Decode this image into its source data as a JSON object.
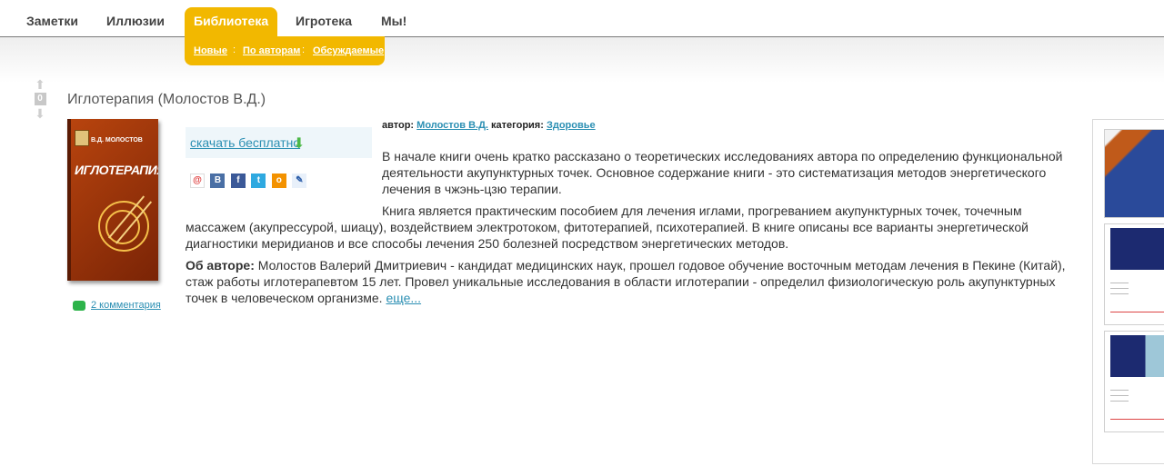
{
  "nav": {
    "items": [
      "Заметки",
      "Иллюзии",
      "Библиотека",
      "Игротека",
      "Мы!"
    ],
    "active_index": 2,
    "subnav": [
      "Новые",
      "По авторам",
      "Обсуждаемые"
    ],
    "sub_sep": ":"
  },
  "vote": {
    "count": "0"
  },
  "book": {
    "title": "Иглотерапия (Молостов В.Д.)",
    "cover_author": "В.Д. МОЛОСТОВ",
    "cover_title": "ИГЛОТЕРАПИЯ",
    "comments": "2 комментария",
    "download": "скачать бесплатно",
    "meta_author_label": "автор:",
    "meta_author": "Молостов В.Д.",
    "meta_category_label": "категория:",
    "meta_category": "Здоровье",
    "p1": "В начале книги очень кратко рассказано о теоретических исследованиях автора по определению функциональной деятельности акупунктурных точек. Основное содержание книги - это систематизация методов энергетического лечения в чжэнь-цзю терапии.",
    "p2": "Книга является практическим пособием для лечения иглами, прогреванием акупунктурных точек, точечным массажем (акупрессурой, шиацу), воздействием электротоком, фитотерапией, психотерапией. В книге описаны все варианты энергетической диагностики меридианов и все способы лечения 250 болезней посредством энергетических методов.",
    "about_label": "Об авторе:",
    "about_text": " Молостов Валерий Дмитриевич - кандидат медицинских наук, прошел годовое обучение восточным методам лечения в Пекине (Китай), стаж работы иглотерапевтом 15 лет. Провел уникальные исследования в области иглотерапии - определил физиологическую роль акупунктурных точек в человеческом организме. ",
    "more": "еще..."
  },
  "share_icons": [
    "mail-ru-icon",
    "vkontakte-icon",
    "facebook-icon",
    "twitter-icon",
    "odnoklassniki-icon",
    "livejournal-icon"
  ],
  "colors": {
    "accent": "#f2b800",
    "link": "#2b8fb3"
  }
}
